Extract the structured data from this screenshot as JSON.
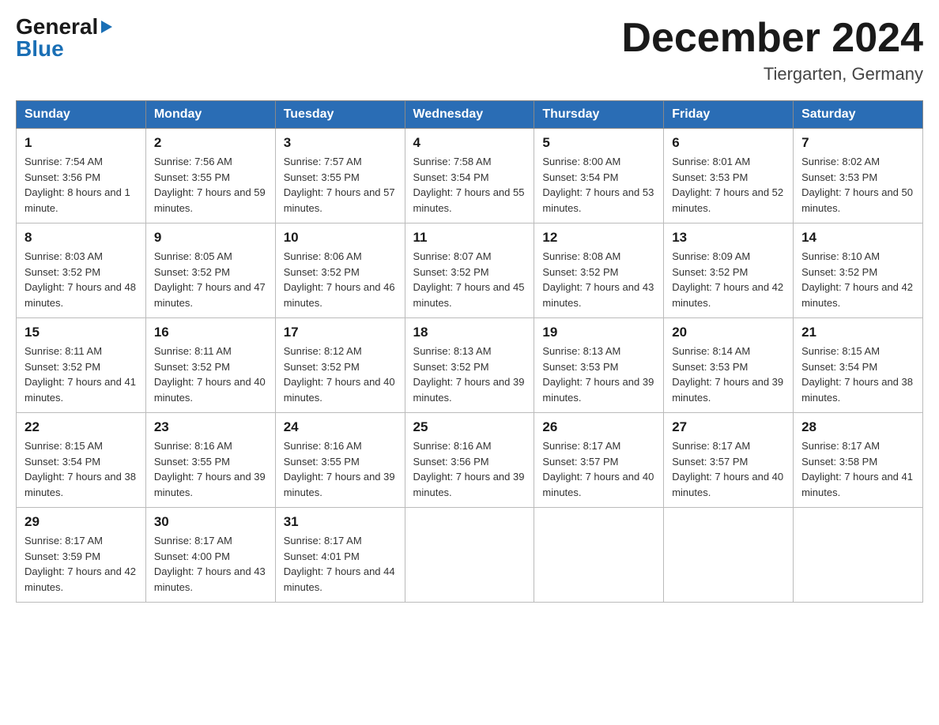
{
  "logo": {
    "general": "General",
    "blue": "Blue",
    "arrow": "▶"
  },
  "title": "December 2024",
  "location": "Tiergarten, Germany",
  "days_of_week": [
    "Sunday",
    "Monday",
    "Tuesday",
    "Wednesday",
    "Thursday",
    "Friday",
    "Saturday"
  ],
  "weeks": [
    [
      {
        "day": "1",
        "sunrise": "7:54 AM",
        "sunset": "3:56 PM",
        "daylight": "8 hours and 1 minute."
      },
      {
        "day": "2",
        "sunrise": "7:56 AM",
        "sunset": "3:55 PM",
        "daylight": "7 hours and 59 minutes."
      },
      {
        "day": "3",
        "sunrise": "7:57 AM",
        "sunset": "3:55 PM",
        "daylight": "7 hours and 57 minutes."
      },
      {
        "day": "4",
        "sunrise": "7:58 AM",
        "sunset": "3:54 PM",
        "daylight": "7 hours and 55 minutes."
      },
      {
        "day": "5",
        "sunrise": "8:00 AM",
        "sunset": "3:54 PM",
        "daylight": "7 hours and 53 minutes."
      },
      {
        "day": "6",
        "sunrise": "8:01 AM",
        "sunset": "3:53 PM",
        "daylight": "7 hours and 52 minutes."
      },
      {
        "day": "7",
        "sunrise": "8:02 AM",
        "sunset": "3:53 PM",
        "daylight": "7 hours and 50 minutes."
      }
    ],
    [
      {
        "day": "8",
        "sunrise": "8:03 AM",
        "sunset": "3:52 PM",
        "daylight": "7 hours and 48 minutes."
      },
      {
        "day": "9",
        "sunrise": "8:05 AM",
        "sunset": "3:52 PM",
        "daylight": "7 hours and 47 minutes."
      },
      {
        "day": "10",
        "sunrise": "8:06 AM",
        "sunset": "3:52 PM",
        "daylight": "7 hours and 46 minutes."
      },
      {
        "day": "11",
        "sunrise": "8:07 AM",
        "sunset": "3:52 PM",
        "daylight": "7 hours and 45 minutes."
      },
      {
        "day": "12",
        "sunrise": "8:08 AM",
        "sunset": "3:52 PM",
        "daylight": "7 hours and 43 minutes."
      },
      {
        "day": "13",
        "sunrise": "8:09 AM",
        "sunset": "3:52 PM",
        "daylight": "7 hours and 42 minutes."
      },
      {
        "day": "14",
        "sunrise": "8:10 AM",
        "sunset": "3:52 PM",
        "daylight": "7 hours and 42 minutes."
      }
    ],
    [
      {
        "day": "15",
        "sunrise": "8:11 AM",
        "sunset": "3:52 PM",
        "daylight": "7 hours and 41 minutes."
      },
      {
        "day": "16",
        "sunrise": "8:11 AM",
        "sunset": "3:52 PM",
        "daylight": "7 hours and 40 minutes."
      },
      {
        "day": "17",
        "sunrise": "8:12 AM",
        "sunset": "3:52 PM",
        "daylight": "7 hours and 40 minutes."
      },
      {
        "day": "18",
        "sunrise": "8:13 AM",
        "sunset": "3:52 PM",
        "daylight": "7 hours and 39 minutes."
      },
      {
        "day": "19",
        "sunrise": "8:13 AM",
        "sunset": "3:53 PM",
        "daylight": "7 hours and 39 minutes."
      },
      {
        "day": "20",
        "sunrise": "8:14 AM",
        "sunset": "3:53 PM",
        "daylight": "7 hours and 39 minutes."
      },
      {
        "day": "21",
        "sunrise": "8:15 AM",
        "sunset": "3:54 PM",
        "daylight": "7 hours and 38 minutes."
      }
    ],
    [
      {
        "day": "22",
        "sunrise": "8:15 AM",
        "sunset": "3:54 PM",
        "daylight": "7 hours and 38 minutes."
      },
      {
        "day": "23",
        "sunrise": "8:16 AM",
        "sunset": "3:55 PM",
        "daylight": "7 hours and 39 minutes."
      },
      {
        "day": "24",
        "sunrise": "8:16 AM",
        "sunset": "3:55 PM",
        "daylight": "7 hours and 39 minutes."
      },
      {
        "day": "25",
        "sunrise": "8:16 AM",
        "sunset": "3:56 PM",
        "daylight": "7 hours and 39 minutes."
      },
      {
        "day": "26",
        "sunrise": "8:17 AM",
        "sunset": "3:57 PM",
        "daylight": "7 hours and 40 minutes."
      },
      {
        "day": "27",
        "sunrise": "8:17 AM",
        "sunset": "3:57 PM",
        "daylight": "7 hours and 40 minutes."
      },
      {
        "day": "28",
        "sunrise": "8:17 AM",
        "sunset": "3:58 PM",
        "daylight": "7 hours and 41 minutes."
      }
    ],
    [
      {
        "day": "29",
        "sunrise": "8:17 AM",
        "sunset": "3:59 PM",
        "daylight": "7 hours and 42 minutes."
      },
      {
        "day": "30",
        "sunrise": "8:17 AM",
        "sunset": "4:00 PM",
        "daylight": "7 hours and 43 minutes."
      },
      {
        "day": "31",
        "sunrise": "8:17 AM",
        "sunset": "4:01 PM",
        "daylight": "7 hours and 44 minutes."
      },
      null,
      null,
      null,
      null
    ]
  ],
  "labels": {
    "sunrise": "Sunrise:",
    "sunset": "Sunset:",
    "daylight": "Daylight:"
  }
}
